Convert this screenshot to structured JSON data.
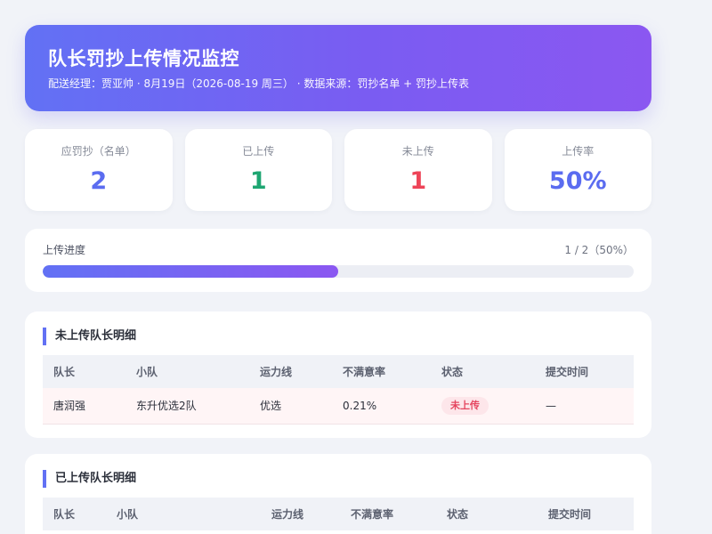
{
  "header": {
    "title": "队长罚抄上传情况监控",
    "subtitle": "配送经理：贾亚帅 · 8月19日（2026-08-19 周三） · 数据来源：罚抄名单 + 罚抄上传表"
  },
  "stats": [
    {
      "label": "应罚抄（名单）",
      "value": "2",
      "color": "#5b6cf0"
    },
    {
      "label": "已上传",
      "value": "1",
      "color": "#1ea672"
    },
    {
      "label": "未上传",
      "value": "1",
      "color": "#ee4458"
    },
    {
      "label": "上传率",
      "value": "50%",
      "color": "#5b6cf0"
    }
  ],
  "progress": {
    "label": "上传进度",
    "text": "1 / 2（50%）",
    "fraction": 0.5
  },
  "pending_table": {
    "title": "未上传队长明细",
    "columns": [
      "队长",
      "小队",
      "运力线",
      "不满意率",
      "状态",
      "提交时间"
    ],
    "rows": [
      {
        "captain": "唐润强",
        "team": "东升优选2队",
        "line": "优选",
        "rate": "0.21%",
        "status": "未上传",
        "time": "—"
      }
    ]
  },
  "uploaded_table": {
    "title": "已上传队长明细",
    "columns": [
      "队长",
      "小队",
      "运力线",
      "不满意率",
      "状态",
      "提交时间"
    ]
  }
}
